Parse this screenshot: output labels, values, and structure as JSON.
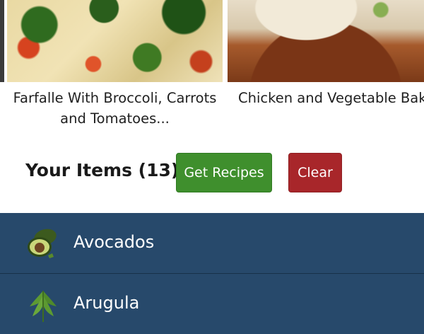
{
  "recipes": [
    {
      "title": "Farfalle With Broccoli, Carrots and Tomatoes..."
    },
    {
      "title": "Chicken and Vegetable Bak"
    }
  ],
  "items": {
    "title": "Your Items (13)",
    "get_recipes_label": "Get Recipes",
    "clear_label": "Clear",
    "list": [
      {
        "name": "Avocados",
        "icon": "avocado-icon"
      },
      {
        "name": "Arugula",
        "icon": "arugula-icon"
      }
    ]
  },
  "colors": {
    "get_recipes": "#3f8f2d",
    "clear": "#a8262a",
    "list_bg": "#27496b"
  }
}
